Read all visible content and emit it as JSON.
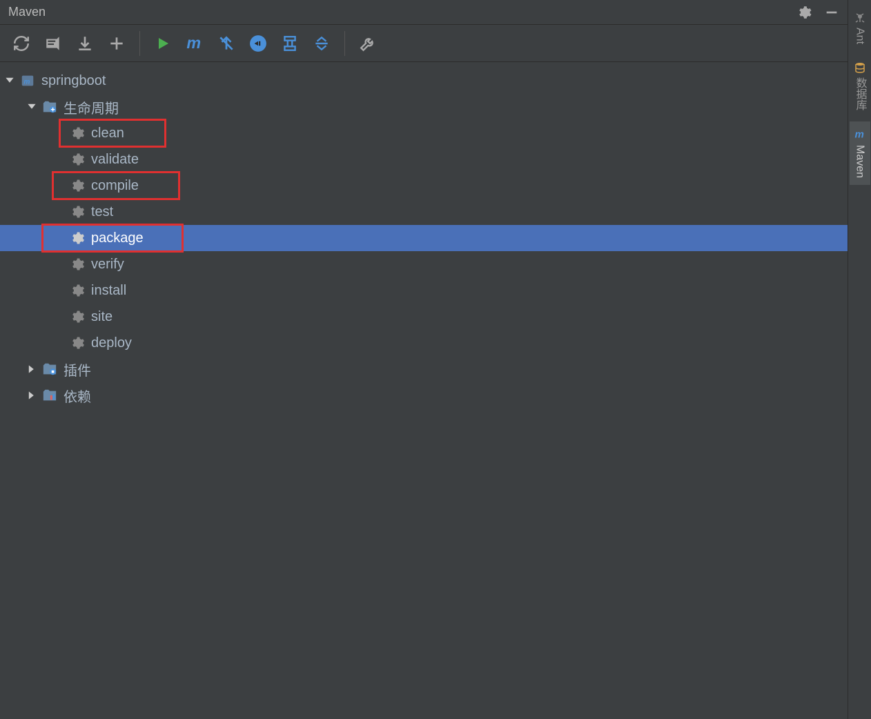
{
  "title": "Maven",
  "sidebar_tabs": [
    {
      "label": "Ant",
      "icon": "ant"
    },
    {
      "label": "数据库",
      "icon": "database"
    },
    {
      "label": "Maven",
      "icon": "maven",
      "active": true
    }
  ],
  "tree": {
    "root": {
      "name": "springboot",
      "expanded": true,
      "children": [
        {
          "name": "生命周期",
          "icon": "folder-lifecycle",
          "expanded": true,
          "phases": [
            {
              "name": "clean",
              "highlight": true
            },
            {
              "name": "validate"
            },
            {
              "name": "compile",
              "highlight": true
            },
            {
              "name": "test"
            },
            {
              "name": "package",
              "highlight": true,
              "selected": true
            },
            {
              "name": "verify"
            },
            {
              "name": "install"
            },
            {
              "name": "site"
            },
            {
              "name": "deploy"
            }
          ]
        },
        {
          "name": "插件",
          "icon": "folder-plugin",
          "expanded": false
        },
        {
          "name": "依赖",
          "icon": "folder-deps",
          "expanded": false
        }
      ]
    }
  }
}
